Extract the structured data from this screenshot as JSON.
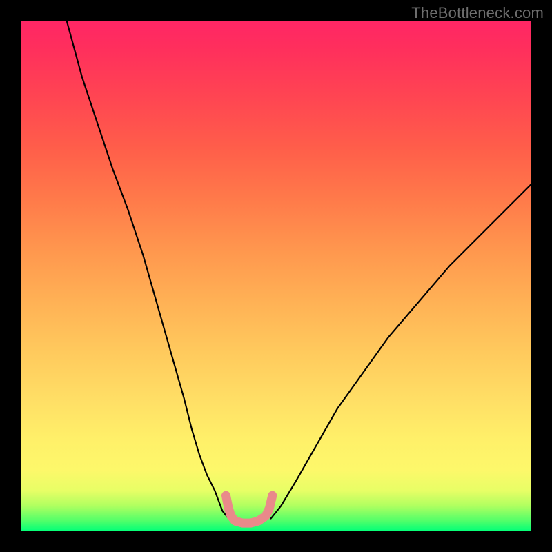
{
  "watermark": "TheBottleneck.com",
  "chart_data": {
    "type": "line",
    "title": "",
    "xlabel": "",
    "ylabel": "",
    "xlim": [
      0,
      100
    ],
    "ylim": [
      0,
      100
    ],
    "series": [
      {
        "name": "left-curve",
        "x": [
          9,
          12,
          15,
          18,
          21,
          24,
          26,
          28,
          30,
          32,
          33.5,
          35,
          36.5,
          38,
          39.5,
          40.7
        ],
        "y": [
          100,
          89,
          80,
          71,
          63,
          54,
          47,
          40,
          33,
          26,
          20,
          15,
          11,
          8,
          4,
          2.5
        ]
      },
      {
        "name": "right-curve",
        "x": [
          49,
          51,
          54,
          58,
          62,
          67,
          72,
          78,
          84,
          90,
          95,
          100
        ],
        "y": [
          2.5,
          5,
          10,
          17,
          24,
          31,
          38,
          45,
          52,
          58,
          63,
          68
        ]
      },
      {
        "name": "valley-marker",
        "x": [
          40.2,
          40.7,
          41.2,
          42,
          43.5,
          45,
          46.5,
          48,
          48.7,
          49.3
        ],
        "y": [
          7,
          4.5,
          3,
          2,
          1.6,
          1.6,
          2,
          3,
          4.5,
          7
        ]
      }
    ],
    "gradient_stops": [
      {
        "pos": 0,
        "color": "#00ff78"
      },
      {
        "pos": 12,
        "color": "#fdf86a"
      },
      {
        "pos": 55,
        "color": "#ff974e"
      },
      {
        "pos": 100,
        "color": "#ff2665"
      }
    ]
  }
}
